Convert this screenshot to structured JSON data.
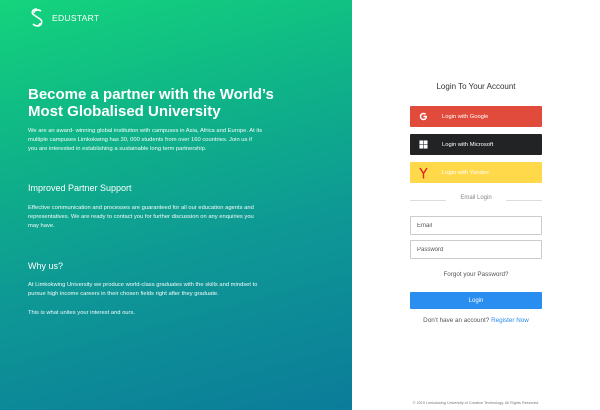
{
  "brand": {
    "name": "EDUSTART",
    "logo_icon": "edustart-logo-icon"
  },
  "hero": {
    "title_line1": "Become a partner with the World’s",
    "title_line2": "Most Globalised University",
    "intro_line1": "We are an award- winning global institution with campuses in Asia, Africa and Europe. At its",
    "intro_line2": "multiple campuses Limkokwing has 30, 000 students from over 160 countries. Join us if",
    "intro_line3": "you are interested in establishing a sustainable long term partnership.",
    "support_heading": "Improved Partner Support",
    "support_line1": "Effective communication and processes are guaranteed for all our education agents and",
    "support_line2": "representatives. We are ready to contact you for further discussion on any enquiries you",
    "support_line3": "may have.",
    "why_heading": "Why us?",
    "why_line1": "At Limkokwing University we produce world-class graduates with the skills and mindset to",
    "why_line2": "pursue high income careers in their chosen fields right after they graduate.",
    "unite_text": "This is what unites your interest and ours."
  },
  "login": {
    "title": "Login To Your Account",
    "google_label": "Login with Google",
    "google_icon": "google-icon",
    "microsoft_label": "Login with Microsoft",
    "microsoft_icon": "microsoft-icon",
    "yandex_label": "Login with Yandex",
    "yandex_icon": "yandex-icon",
    "divider_text": "Email Login",
    "email_placeholder": "Email",
    "password_placeholder": "Password",
    "forgot_text": "Forgot your Password?",
    "submit_label": "Login",
    "no_account_text": "Don’t have an account?",
    "register_link": "Register Now"
  },
  "footer": {
    "copyright": "© 2019 Limkokwing University of Creative Technology. All Rights Reserved."
  },
  "colors": {
    "hero_gradient_start": "#14d47c",
    "hero_gradient_end": "#0b7c9a",
    "google": "#e14b3b",
    "microsoft": "#222325",
    "yandex": "#ffd94a",
    "primary": "#2a8ef0"
  }
}
